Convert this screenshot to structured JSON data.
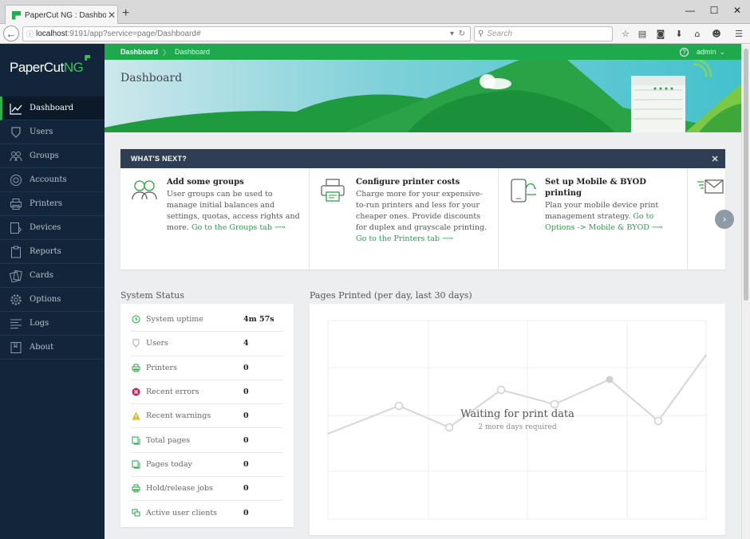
{
  "browser": {
    "tab_title": "PaperCut NG : Dashboard ...",
    "url_host": "localhost",
    "url_path": ":9191/app?service=page/Dashboard#",
    "search_placeholder": "Search"
  },
  "sidebar": {
    "logo_main": "PaperCut",
    "logo_suffix": "NG",
    "items": [
      {
        "label": "Dashboard",
        "icon": "chart-line-icon"
      },
      {
        "label": "Users",
        "icon": "user-icon"
      },
      {
        "label": "Groups",
        "icon": "group-icon"
      },
      {
        "label": "Accounts",
        "icon": "coins-icon"
      },
      {
        "label": "Printers",
        "icon": "printer-icon"
      },
      {
        "label": "Devices",
        "icon": "device-icon"
      },
      {
        "label": "Reports",
        "icon": "clipboard-icon"
      },
      {
        "label": "Cards",
        "icon": "cards-icon"
      },
      {
        "label": "Options",
        "icon": "gear-icon"
      },
      {
        "label": "Logs",
        "icon": "list-icon"
      },
      {
        "label": "About",
        "icon": "book-icon"
      }
    ]
  },
  "breadcrumb": {
    "first": "Dashboard",
    "second": "Dashboard"
  },
  "user": {
    "name": "admin"
  },
  "page_title": "Dashboard",
  "whats_next": {
    "title": "WHAT'S NEXT?",
    "cards": [
      {
        "title": "Add some groups",
        "body": "User groups can be used to manage initial balances and settings, quotas, access rights and more.",
        "link": "Go to the Groups tab"
      },
      {
        "title": "Configure printer costs",
        "body": "Charge more for your expensive-to-run printers and less for your cheaper ones. Provide discounts for duplex and grayscale printing.",
        "link": "Go to the Printers tab"
      },
      {
        "title": "Set up Mobile & BYOD printing",
        "body": "Plan your mobile device print management strategy.",
        "link": "Go to Options -> Mobile & BYOD"
      }
    ]
  },
  "system_status": {
    "title": "System Status",
    "rows": [
      {
        "label": "System uptime",
        "value": "4m 57s",
        "icon": "clock-icon"
      },
      {
        "label": "Users",
        "value": "4",
        "icon": "user-icon"
      },
      {
        "label": "Printers",
        "value": "0",
        "icon": "printer-icon"
      },
      {
        "label": "Recent errors",
        "value": "0",
        "icon": "error-icon"
      },
      {
        "label": "Recent warnings",
        "value": "0",
        "icon": "warning-icon"
      },
      {
        "label": "Total pages",
        "value": "0",
        "icon": "pages-icon"
      },
      {
        "label": "Pages today",
        "value": "0",
        "icon": "pages-icon"
      },
      {
        "label": "Hold/release jobs",
        "value": "0",
        "icon": "printer-icon"
      },
      {
        "label": "Active user clients",
        "value": "0",
        "icon": "clients-icon"
      }
    ]
  },
  "pages_printed": {
    "title": "Pages Printed (per day, last 30 days)",
    "waiting": "Waiting for print data",
    "required": "2 more days required"
  },
  "colors": {
    "accent": "#1ea94d",
    "sidebar": "#12253a",
    "panel_header": "#2f3e52",
    "error": "#d0245c",
    "warning": "#f0b400"
  }
}
